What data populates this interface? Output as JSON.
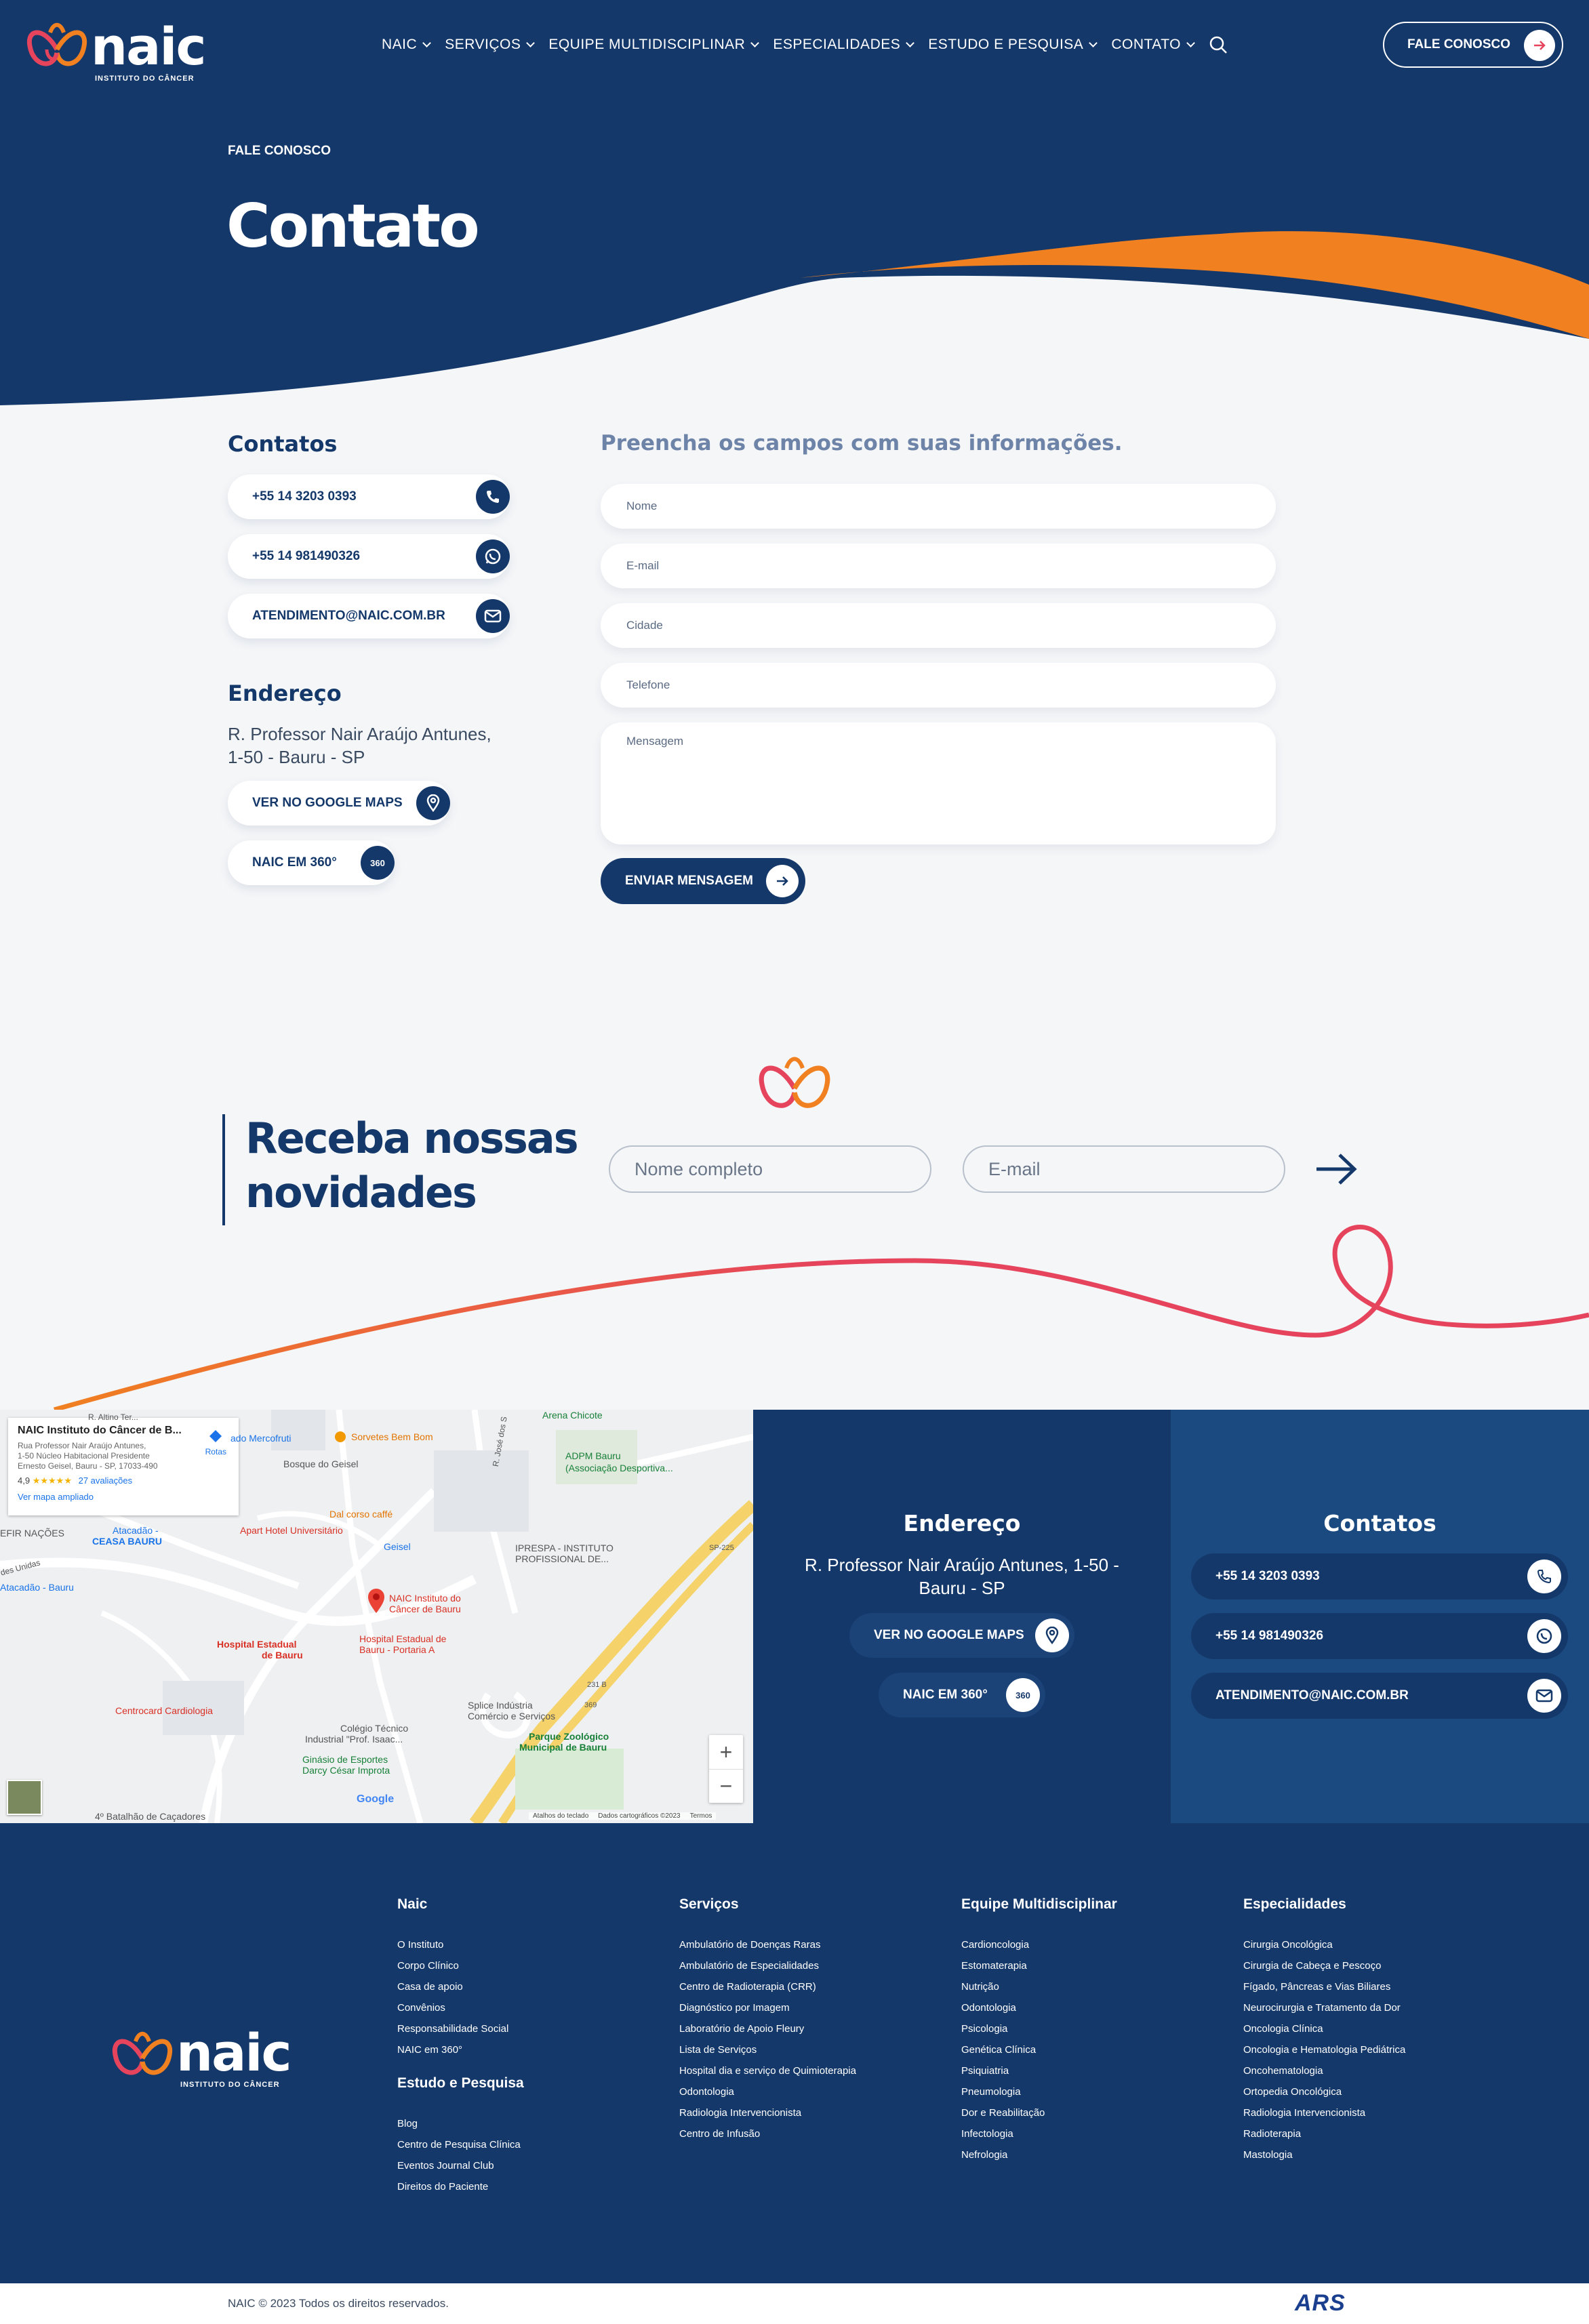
{
  "brand": {
    "name": "naic",
    "tagline": "INSTITUTO DO CÂNCER"
  },
  "nav": {
    "items": [
      {
        "label": "NAIC"
      },
      {
        "label": "SERVIÇOS"
      },
      {
        "label": "EQUIPE MULTIDISCIPLINAR"
      },
      {
        "label": "ESPECIALIDADES"
      },
      {
        "label": "ESTUDO E PESQUISA"
      },
      {
        "label": "CONTATO"
      }
    ],
    "cta_label": "FALE CONOSCO"
  },
  "hero": {
    "eyebrow": "FALE CONOSCO",
    "title": "Contato"
  },
  "contacts": {
    "title": "Contatos",
    "phone": "+55 14 3203 0393",
    "whatsapp": "+55 14 981490326",
    "email": "ATENDIMENTO@NAIC.COM.BR"
  },
  "address": {
    "title": "Endereço",
    "line1": "R. Professor Nair Araújo Antunes,",
    "line2": "1-50 - Bauru - SP",
    "maps_label": "VER NO GOOGLE MAPS",
    "tour_label": "NAIC EM 360°"
  },
  "form": {
    "title": "Preencha os campos com suas informações.",
    "name_placeholder": "Nome",
    "email_placeholder": "E-mail",
    "city_placeholder": "Cidade",
    "phone_placeholder": "Telefone",
    "message_placeholder": "Mensagem",
    "submit_label": "ENVIAR MENSAGEM"
  },
  "newsletter": {
    "title_line1": "Receba nossas",
    "title_line2": "novidades",
    "name_placeholder": "Nome completo",
    "email_placeholder": "E-mail"
  },
  "map": {
    "card_title": "NAIC Instituto do Câncer de B...",
    "card_address_1": "Rua Professor Nair Araújo Antunes,",
    "card_address_2": "1-50 Núcleo Habitacional Presidente",
    "card_address_3": "Ernesto Geisel, Bauru - SP, 17033-490",
    "rating": "4,9",
    "stars": "★★★★★",
    "reviews": "27 avaliações",
    "enlarge": "Ver mapa ampliado",
    "routes": "Rotas",
    "attribution": "Google",
    "footer_links": [
      "Atalhos do teclado",
      "Dados cartográficos ©2023",
      "Termos"
    ],
    "zoom_in": "+",
    "zoom_out": "−",
    "places": {
      "sorvetes": "Sorvetes Bem Bom",
      "mercofruti": "ado Mercofruti",
      "bosque": "Bosque do Geisel",
      "arena": "Arena Chicote",
      "adpm1": "ADPM Bauru",
      "adpm2": "(Associação Desportiva...",
      "dalcorso": "Dal corso caffé",
      "apart": "Apart Hotel Universitário",
      "geisel": "Geisel",
      "iprespa1": "IPRESPA - INSTITUTO",
      "iprespa2": "PROFISSIONAL DE...",
      "naic1": "NAIC Instituto do",
      "naic2": "Câncer de Bauru",
      "atacadao1": "Atacadão -",
      "atacadao2": "CEASA BAURU",
      "atacadao3": "Atacadão - Bauru",
      "nacoes": "EFIR NAÇÕES",
      "unidas": "des Unidas",
      "hosp1a": "Hospital Estadual",
      "hosp1b": "de Bauru",
      "hosp2a": "Hospital Estadual de",
      "hosp2b": "Bauru - Portaria A",
      "centrocard": "Centrocard Cardiologia",
      "splice1": "Splice Indústria",
      "splice2": "Comércio e Serviços",
      "colegio1": "Colégio Técnico",
      "colegio2": "Industrial \"Prof. Isaac...",
      "zoo1": "Parque Zoológico",
      "zoo2": "Municipal de Bauru",
      "ginasio1": "Ginásio de Esportes",
      "ginasio2": "Darcy César Improta",
      "batalhao": "4º Batalhão de Caçadores",
      "altino": "R. Altino Ter...",
      "rjose": "R. José dos S",
      "sp225": "SP-225",
      "r231": "231 B",
      "r369": "369"
    }
  },
  "footer_info": {
    "address_title": "Endereço",
    "address_line1": "R. Professor Nair Araújo Antunes, 1-50 -",
    "address_line2": "Bauru - SP",
    "maps_label": "VER NO GOOGLE MAPS",
    "tour_label": "NAIC EM 360°",
    "contacts_title": "Contatos",
    "phone": "+55 14 3203 0393",
    "whatsapp": "+55 14 981490326",
    "email": "ATENDIMENTO@NAIC.COM.BR"
  },
  "footer": {
    "col1": {
      "title": "Naic",
      "items": [
        "O Instituto",
        "Corpo Clínico",
        "Casa de apoio",
        "Convênios",
        "Responsabilidade Social",
        "NAIC em 360°"
      ]
    },
    "col1b": {
      "title": "Estudo e Pesquisa",
      "items": [
        "Blog",
        "Centro de Pesquisa Clínica",
        "Eventos Journal Club",
        "Direitos do Paciente"
      ]
    },
    "col2": {
      "title": "Serviços",
      "items": [
        "Ambulatório de Doenças Raras",
        "Ambulatório de Especialidades",
        "Centro de Radioterapia (CRR)",
        "Diagnóstico por Imagem",
        "Laboratório de Apoio Fleury",
        "Lista de Serviços",
        "Hospital dia e serviço de Quimioterapia",
        "Odontologia",
        "Radiologia Intervencionista",
        "Centro de Infusão"
      ]
    },
    "col3": {
      "title": "Equipe Multidisciplinar",
      "items": [
        "Cardioncologia",
        "Estomaterapia",
        "Nutrição",
        "Odontologia",
        "Psicologia",
        "Genética Clínica",
        "Psiquiatria",
        "Pneumologia",
        "Dor e Reabilitação",
        "Infectologia",
        "Nefrologia"
      ]
    },
    "col4": {
      "title": "Especialidades",
      "items": [
        "Cirurgia Oncológica",
        "Cirurgia de Cabeça e Pescoço",
        "Fígado, Pâncreas e Vias Biliares",
        "Neurocirurgia e Tratamento da Dor",
        "Oncologia Clínica",
        "Oncologia e Hematologia Pediátrica",
        "Oncohematologia",
        "Ortopedia Oncológica",
        "Radiologia Intervencionista",
        "Radioterapia",
        "Mastologia"
      ]
    },
    "copyright": "NAIC © 2023 Todos os direitos reservados.",
    "agency": "ARS"
  },
  "colors": {
    "navy": "#14386a",
    "orange": "#f08020",
    "pink": "#e5445c",
    "bg": "#f5f6f8"
  }
}
